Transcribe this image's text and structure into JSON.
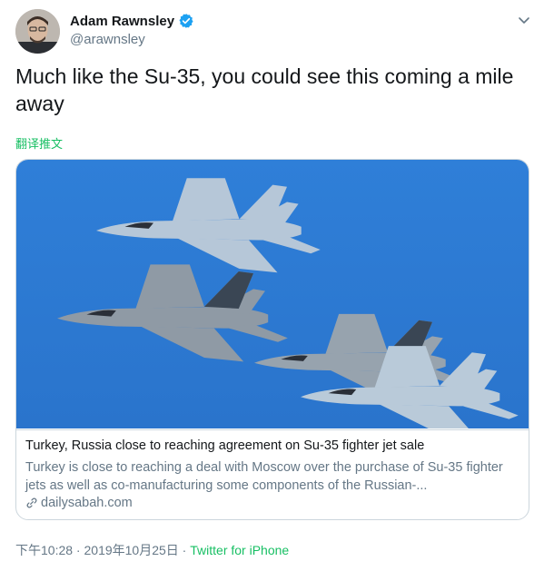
{
  "author": {
    "name": "Adam Rawnsley",
    "handle": "@arawnsley",
    "verified_color": "#1da1f2"
  },
  "tweet": {
    "text": "Much like the Su-35, you could see this coming a mile away",
    "translate_label": "翻译推文"
  },
  "card": {
    "image_icon": "fighter-jets-photo",
    "title": "Turkey, Russia close to reaching agreement on Su-35 fighter jet sale",
    "description": "Turkey is close to reaching a deal with Moscow over the purchase of Su-35 fighter jets as well as co-manufacturing some components of the Russian-...",
    "domain": "dailysabah.com",
    "link_icon": "link-icon"
  },
  "meta": {
    "time": "下午10:28",
    "separator1": " · ",
    "date": "2019年10月25日",
    "separator2": " · ",
    "source": "Twitter for iPhone"
  },
  "colors": {
    "accent_green": "#17bf63",
    "secondary_text": "#657786",
    "sky_blue": "#2e7fd6"
  }
}
